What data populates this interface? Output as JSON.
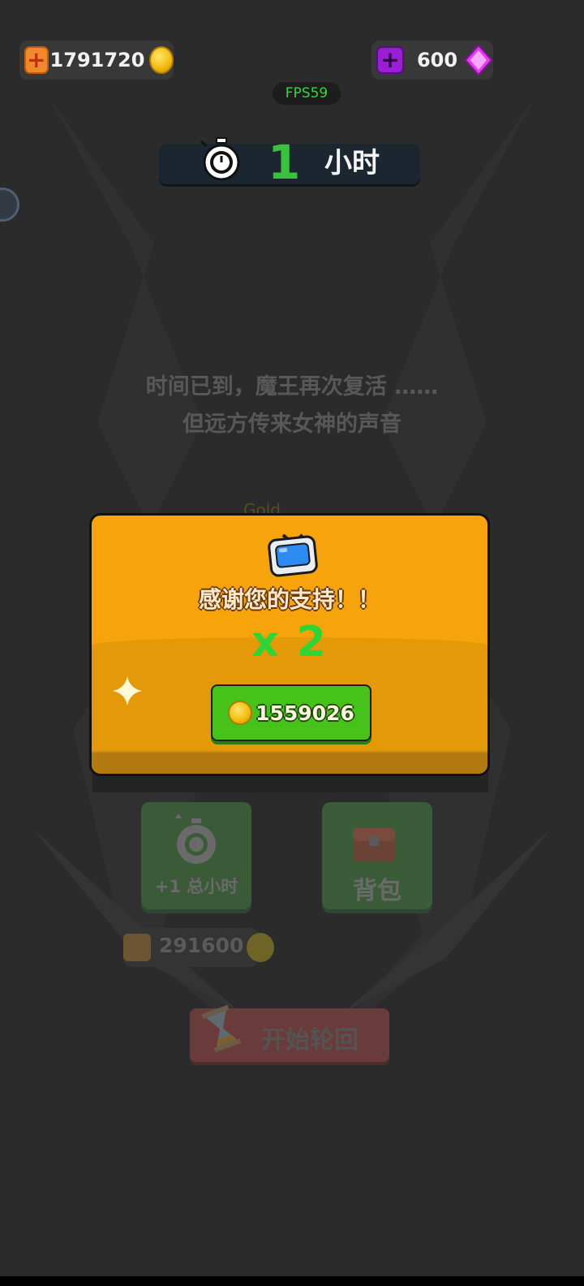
{
  "header": {
    "gold_amount": "1791720",
    "gem_amount": "600",
    "fps": "FPS59"
  },
  "timer": {
    "value": "1",
    "unit": "小时"
  },
  "story": {
    "line1": "时间已到，魔王再次复活 ……",
    "line2": "但远方传来女神的声音"
  },
  "background_text": {
    "gold": "Gold",
    "hours_button": "+1 总小时",
    "bag_button": "背包",
    "cost_amount": "291600",
    "rebirth_button": "开始轮回"
  },
  "dialog": {
    "message": "感谢您的支持！！",
    "multiplier": "x 2",
    "reward_amount": "1559026"
  },
  "colors": {
    "dialog_orange": "#f6a30c",
    "claim_green": "#46c21b",
    "multiplier_green": "#2fd534",
    "fps_green": "#39d23c"
  }
}
